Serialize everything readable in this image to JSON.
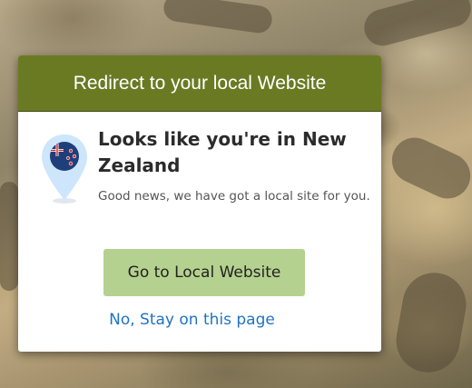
{
  "modal": {
    "header_title": "Redirect to your local Website",
    "headline": "Looks like you're in New Zealand",
    "subtext": "Good news, we have got a local site for you.",
    "primary_button_label": "Go to Local Website",
    "secondary_link_label": "No, Stay on this page",
    "flag_icon": "new-zealand-flag-pin-icon"
  },
  "colors": {
    "header_bg": "#6a7a23",
    "button_bg": "#b5d18f",
    "link": "#1f73c4",
    "pin": "#cde6fb"
  }
}
